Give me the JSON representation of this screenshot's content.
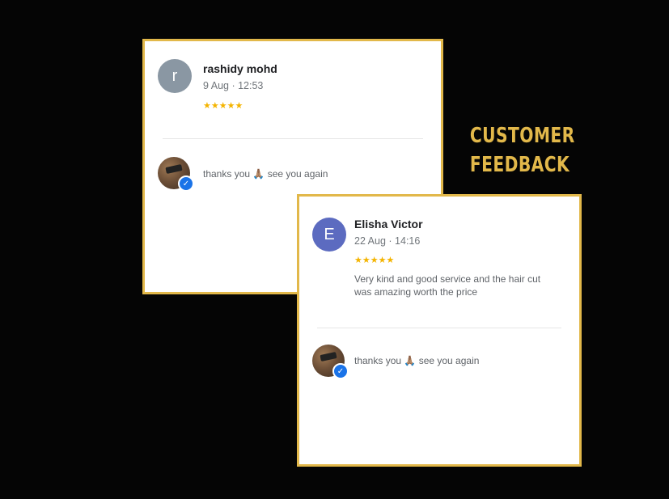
{
  "heading": {
    "line1": "CUSTOMER",
    "line2": "FEEDBACK"
  },
  "colors": {
    "accent": "#e2b84a",
    "background": "#050505",
    "star": "#f4b400",
    "verified": "#1a73e8"
  },
  "reviews": [
    {
      "avatar_letter": "r",
      "avatar_color": "#8a97a3",
      "name": "rashidy mohd",
      "date": "9 Aug · 12:53",
      "stars": "★★★★★",
      "rating": 5,
      "text": "",
      "reply": {
        "text_before": "thanks you",
        "emoji": "🙏🏽",
        "text_after": "see you again",
        "icon": "verified-check-icon"
      }
    },
    {
      "avatar_letter": "E",
      "avatar_color": "#5c6bc0",
      "name": "Elisha Victor",
      "date": "22 Aug · 14:16",
      "stars": "★★★★★",
      "rating": 5,
      "text": "Very kind and good service and the hair cut was amazing worth the price",
      "reply": {
        "text_before": "thanks you",
        "emoji": "🙏🏽",
        "text_after": "see you again",
        "icon": "verified-check-icon"
      }
    }
  ]
}
